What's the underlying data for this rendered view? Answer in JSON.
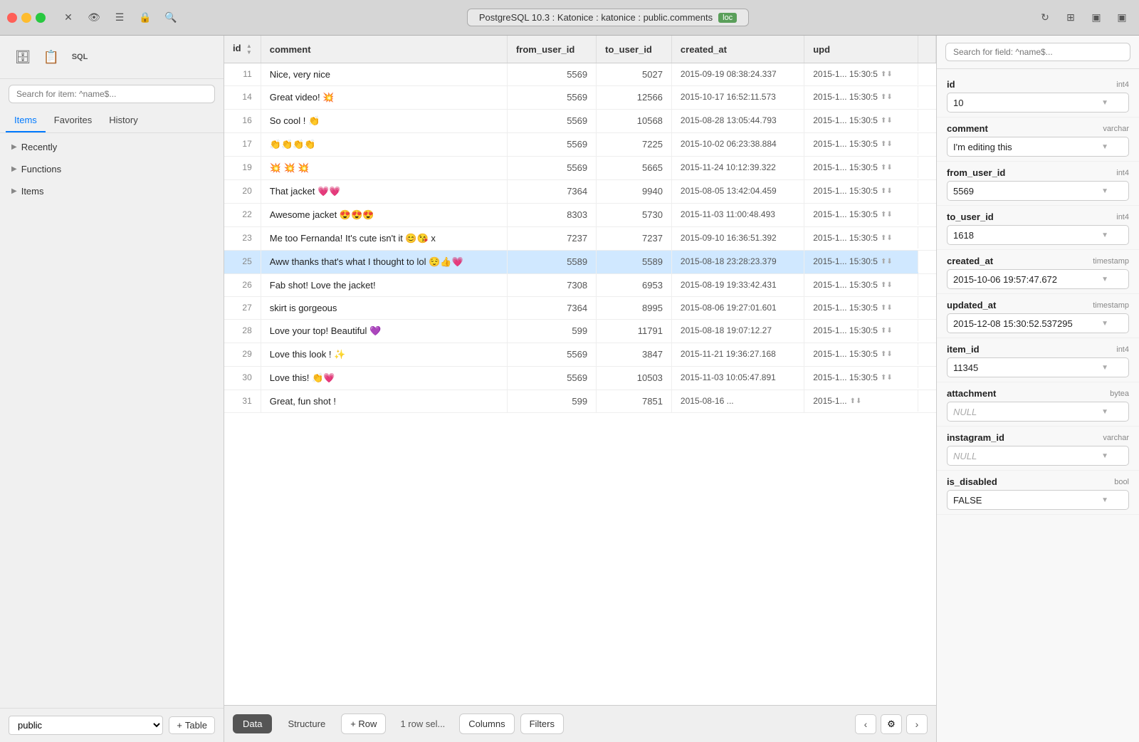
{
  "titlebar": {
    "db_label": "PostgreSQL 10.3 : Katonice : katonice : public.comments",
    "loc_badge": "loc"
  },
  "sidebar": {
    "search_placeholder": "Search for item: ^name$...",
    "tabs": [
      "Items",
      "Favorites",
      "History"
    ],
    "active_tab": "Items",
    "nav_items": [
      {
        "label": "Recently",
        "arrow": "▶"
      },
      {
        "label": "Functions",
        "arrow": "▶"
      },
      {
        "label": "Items",
        "arrow": "▶"
      }
    ],
    "bottom_schema": "public",
    "add_table": "+ Table"
  },
  "table": {
    "columns": [
      "id",
      "comment",
      "from_user_id",
      "to_user_id",
      "created_at",
      "upd"
    ],
    "rows": [
      {
        "id": 11,
        "comment": "Nice, very nice",
        "from_user_id": 5569,
        "to_user_id": 5027,
        "created_at": "2015-09-19 08:38:24.337",
        "upd": "2015-1... 15:30:5"
      },
      {
        "id": 14,
        "comment": "Great video! 💥",
        "from_user_id": 5569,
        "to_user_id": 12566,
        "created_at": "2015-10-17 16:52:11.573",
        "upd": "2015-1... 15:30:5"
      },
      {
        "id": 16,
        "comment": "So cool ! 👏",
        "from_user_id": 5569,
        "to_user_id": 10568,
        "created_at": "2015-08-28 13:05:44.793",
        "upd": "2015-1... 15:30:5"
      },
      {
        "id": 17,
        "comment": "👏👏👏👏",
        "from_user_id": 5569,
        "to_user_id": 7225,
        "created_at": "2015-10-02 06:23:38.884",
        "upd": "2015-1... 15:30:5"
      },
      {
        "id": 19,
        "comment": "💥 💥 💥",
        "from_user_id": 5569,
        "to_user_id": 5665,
        "created_at": "2015-11-24 10:12:39.322",
        "upd": "2015-1... 15:30:5"
      },
      {
        "id": 20,
        "comment": "That jacket 💗💗",
        "from_user_id": 7364,
        "to_user_id": 9940,
        "created_at": "2015-08-05 13:42:04.459",
        "upd": "2015-1... 15:30:5"
      },
      {
        "id": 22,
        "comment": "Awesome jacket 😍😍😍",
        "from_user_id": 8303,
        "to_user_id": 5730,
        "created_at": "2015-11-03 11:00:48.493",
        "upd": "2015-1... 15:30:5"
      },
      {
        "id": 23,
        "comment": "Me too Fernanda! It's cute isn't it 😊😘 x",
        "from_user_id": 7237,
        "to_user_id": 7237,
        "created_at": "2015-09-10 16:36:51.392",
        "upd": "2015-1... 15:30:5"
      },
      {
        "id": 25,
        "comment": "Aww thanks that's what I thought to lol 😌👍💗",
        "from_user_id": 5589,
        "to_user_id": 5589,
        "created_at": "2015-08-18 23:28:23.379",
        "upd": "2015-1... 15:30:5"
      },
      {
        "id": 26,
        "comment": "Fab shot! Love the jacket!",
        "from_user_id": 7308,
        "to_user_id": 6953,
        "created_at": "2015-08-19 19:33:42.431",
        "upd": "2015-1... 15:30:5"
      },
      {
        "id": 27,
        "comment": "skirt is gorgeous",
        "from_user_id": 7364,
        "to_user_id": 8995,
        "created_at": "2015-08-06 19:27:01.601",
        "upd": "2015-1... 15:30:5"
      },
      {
        "id": 28,
        "comment": "Love your top! Beautiful 💜",
        "from_user_id": 599,
        "to_user_id": 11791,
        "created_at": "2015-08-18 19:07:12.27",
        "upd": "2015-1... 15:30:5"
      },
      {
        "id": 29,
        "comment": "Love this look ! ✨",
        "from_user_id": 5569,
        "to_user_id": 3847,
        "created_at": "2015-11-21 19:36:27.168",
        "upd": "2015-1... 15:30:5"
      },
      {
        "id": 30,
        "comment": "Love this! 👏💗",
        "from_user_id": 5569,
        "to_user_id": 10503,
        "created_at": "2015-11-03 10:05:47.891",
        "upd": "2015-1... 15:30:5"
      },
      {
        "id": 31,
        "comment": "Great, fun shot !",
        "from_user_id": 599,
        "to_user_id": 7851,
        "created_at": "2015-08-16 ...",
        "upd": "2015-1..."
      }
    ],
    "selected_row_id": 25
  },
  "bottom_bar": {
    "tabs": [
      "Data",
      "Structure"
    ],
    "active_tab": "Data",
    "add_row": "+ Row",
    "status": "1 row sel...",
    "columns_btn": "Columns",
    "filters_btn": "Filters"
  },
  "right_panel": {
    "search_placeholder": "Search for field: ^name$...",
    "fields": [
      {
        "name": "id",
        "type": "int4",
        "value": "10",
        "null": false
      },
      {
        "name": "comment",
        "type": "varchar",
        "value": "I'm editing this",
        "null": false
      },
      {
        "name": "from_user_id",
        "type": "int4",
        "value": "5569",
        "null": false
      },
      {
        "name": "to_user_id",
        "type": "int4",
        "value": "1618",
        "null": false
      },
      {
        "name": "created_at",
        "type": "timestamp",
        "value": "2015-10-06 19:57:47.672",
        "null": false
      },
      {
        "name": "updated_at",
        "type": "timestamp",
        "value": "2015-12-08 15:30:52.537295",
        "null": false
      },
      {
        "name": "item_id",
        "type": "int4",
        "value": "11345",
        "null": false
      },
      {
        "name": "attachment",
        "type": "bytea",
        "value": "NULL",
        "null": true
      },
      {
        "name": "instagram_id",
        "type": "varchar",
        "value": "NULL",
        "null": true
      },
      {
        "name": "is_disabled",
        "type": "bool",
        "value": "FALSE",
        "null": false
      }
    ]
  }
}
